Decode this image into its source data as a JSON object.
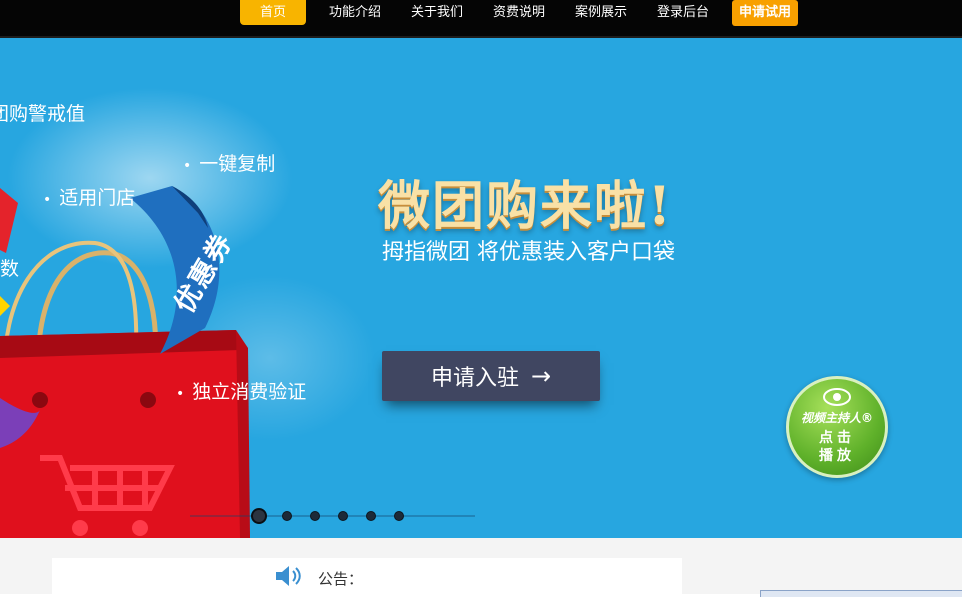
{
  "nav": {
    "items": [
      {
        "label": "首页",
        "active": true
      },
      {
        "label": "功能介绍"
      },
      {
        "label": "关于我们"
      },
      {
        "label": "资费说明"
      },
      {
        "label": "案例展示"
      },
      {
        "label": "登录后台"
      },
      {
        "label": "申请试用",
        "highlight": true
      }
    ],
    "accent_color": "#f8b400"
  },
  "hero": {
    "background_color": "#27a6e0",
    "features": [
      "团购警戒值",
      "一键复制",
      "适用门店",
      "数",
      "独立消费验证"
    ],
    "coupon_ribbon": "优惠券",
    "headline": "微团购来啦!",
    "subtitle": "拇指微团 将优惠装入客户口袋",
    "cta": {
      "label": "申请入驻",
      "icon": "arrow-right-icon"
    },
    "video_host": {
      "title": "视频主持人®",
      "line1": "点击",
      "line2": "播放"
    },
    "carousel": {
      "count": 6,
      "active_index": 0
    }
  },
  "notice": {
    "icon": "speaker-icon",
    "label": "公告："
  }
}
